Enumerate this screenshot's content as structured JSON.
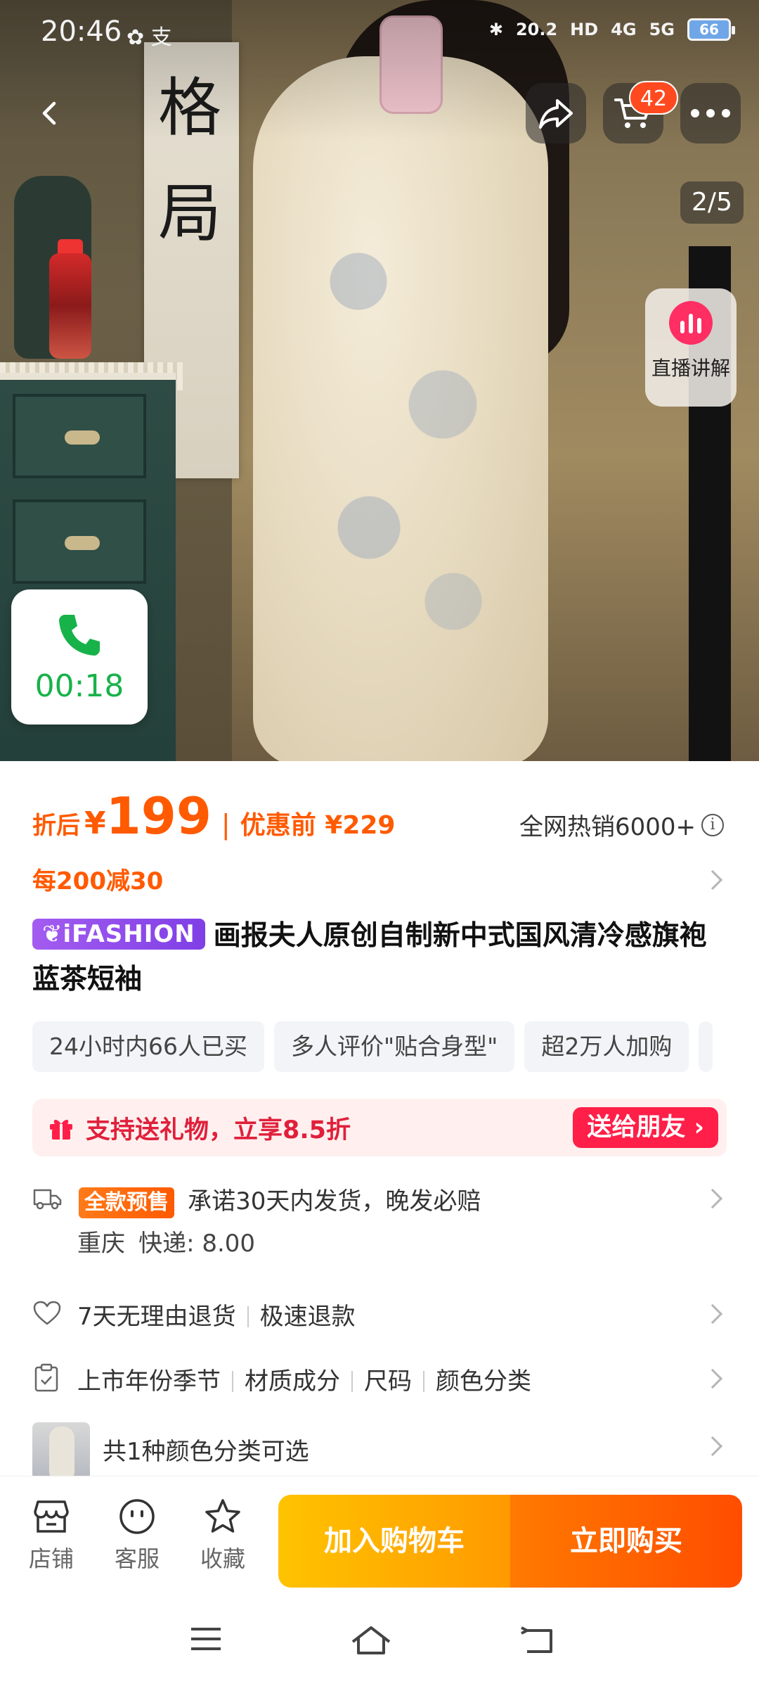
{
  "status_bar": {
    "time": "20:46",
    "left_icons": "✿ 支",
    "network_speed": "20.2",
    "hd": "HD",
    "signal_1": "4G",
    "signal_2": "5G",
    "battery": "66"
  },
  "hero": {
    "cart_count": "42",
    "page_indicator": "2/5",
    "live_label": "直播讲解",
    "call_time": "00:18",
    "scroll_text": [
      "格",
      "局"
    ]
  },
  "price": {
    "label": "折后",
    "currency": "¥",
    "value": "199",
    "separator": "|",
    "original": "优惠前 ¥229",
    "hot_sales": "全网热销6000+"
  },
  "promo": {
    "text": "每200减30"
  },
  "product": {
    "brand_badge": "iFASHION",
    "title": "画报夫人原创自制新中式国风清冷感旗袍 蓝茶短袖"
  },
  "tags": [
    "24小时内66人已买",
    "多人评价\"贴合身型\"",
    "超2万人加购"
  ],
  "gift": {
    "text": "支持送礼物，立享8.5折",
    "button": "送给朋友 ›"
  },
  "shipping": {
    "badge": "全款预售",
    "text": "承诺30天内发货，晚发必赔",
    "origin": "重庆",
    "fee": "快递: 8.00"
  },
  "service": {
    "items": [
      "7天无理由退货",
      "极速退款"
    ]
  },
  "params": {
    "items": [
      "上市年份季节",
      "材质成分",
      "尺码",
      "颜色分类"
    ]
  },
  "colors": {
    "text": "共1种颜色分类可选"
  },
  "action_bar": {
    "shop": "店铺",
    "service": "客服",
    "favorite": "收藏",
    "add_to_cart": "加入购物车",
    "buy_now": "立即购买"
  },
  "colors_theme": {
    "accent_orange": "#ff5a00",
    "gift_red": "#ff1f48",
    "call_green": "#17b24a",
    "live_pink": "#ff2e63",
    "ifashion_purple": "#8e48ea"
  }
}
